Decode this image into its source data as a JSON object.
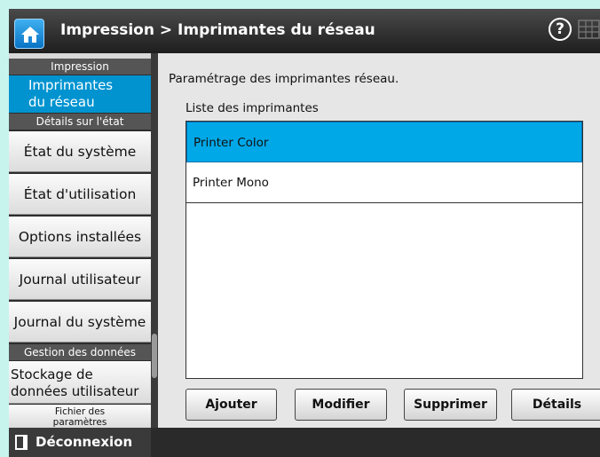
{
  "header": {
    "title": "Impression > Imprimantes du réseau",
    "help_glyph": "?"
  },
  "sidebar": {
    "section_impression": "Impression",
    "active_item": {
      "line1": "Imprimantes",
      "line2": "du réseau"
    },
    "section_details": "Détails sur l'état",
    "items": [
      "État du système",
      "État d'utilisation",
      "Options installées",
      "Journal utilisateur",
      "Journal du système"
    ],
    "section_data": "Gestion des données",
    "storage_item": {
      "line1": "Stockage de",
      "line2": "données utilisateur"
    },
    "partial_item": {
      "line1": "Fichier des",
      "line2": "paramètres"
    },
    "logout_label": "Déconnexion"
  },
  "main": {
    "description": "Paramétrage des imprimantes réseau.",
    "list_label": "Liste des imprimantes",
    "printers": [
      "Printer Color",
      "Printer Mono"
    ],
    "selected_index": 0,
    "buttons": {
      "add": "Ajouter",
      "modify": "Modifier",
      "delete": "Supprimer",
      "details": "Détails"
    }
  },
  "colors": {
    "accent": "#0093d0",
    "selection": "#00a8e8",
    "page_background": "#c8f4ee"
  },
  "icons": {
    "home": "home-icon",
    "help": "help-icon",
    "grid": "grid-icon",
    "logout": "logout-icon"
  }
}
